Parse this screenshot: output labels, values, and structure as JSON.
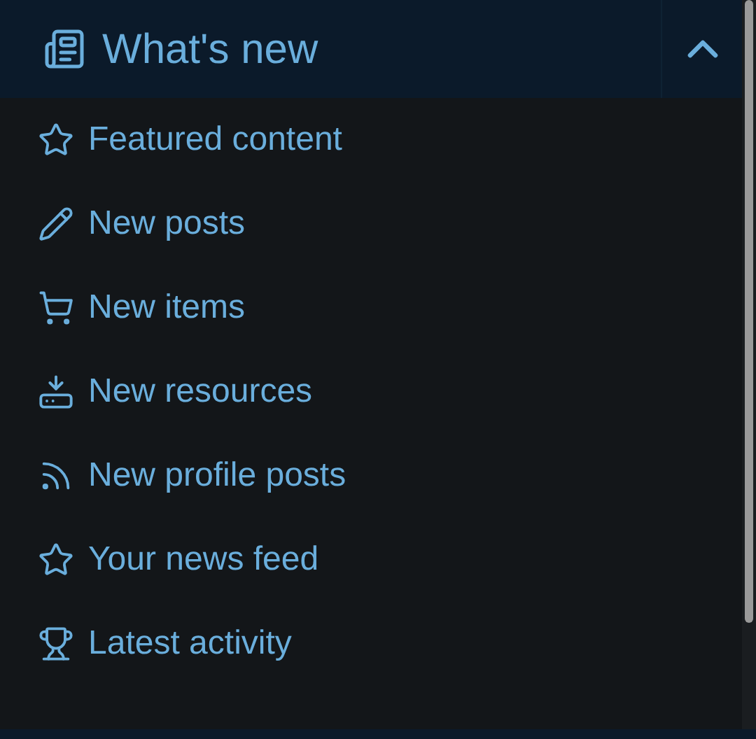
{
  "section": {
    "title": "What's new",
    "expanded": true
  },
  "items": [
    {
      "label": "Featured content"
    },
    {
      "label": "New posts"
    },
    {
      "label": "New items"
    },
    {
      "label": "New resources"
    },
    {
      "label": "New profile posts"
    },
    {
      "label": "Your news feed"
    },
    {
      "label": "Latest activity"
    }
  ]
}
